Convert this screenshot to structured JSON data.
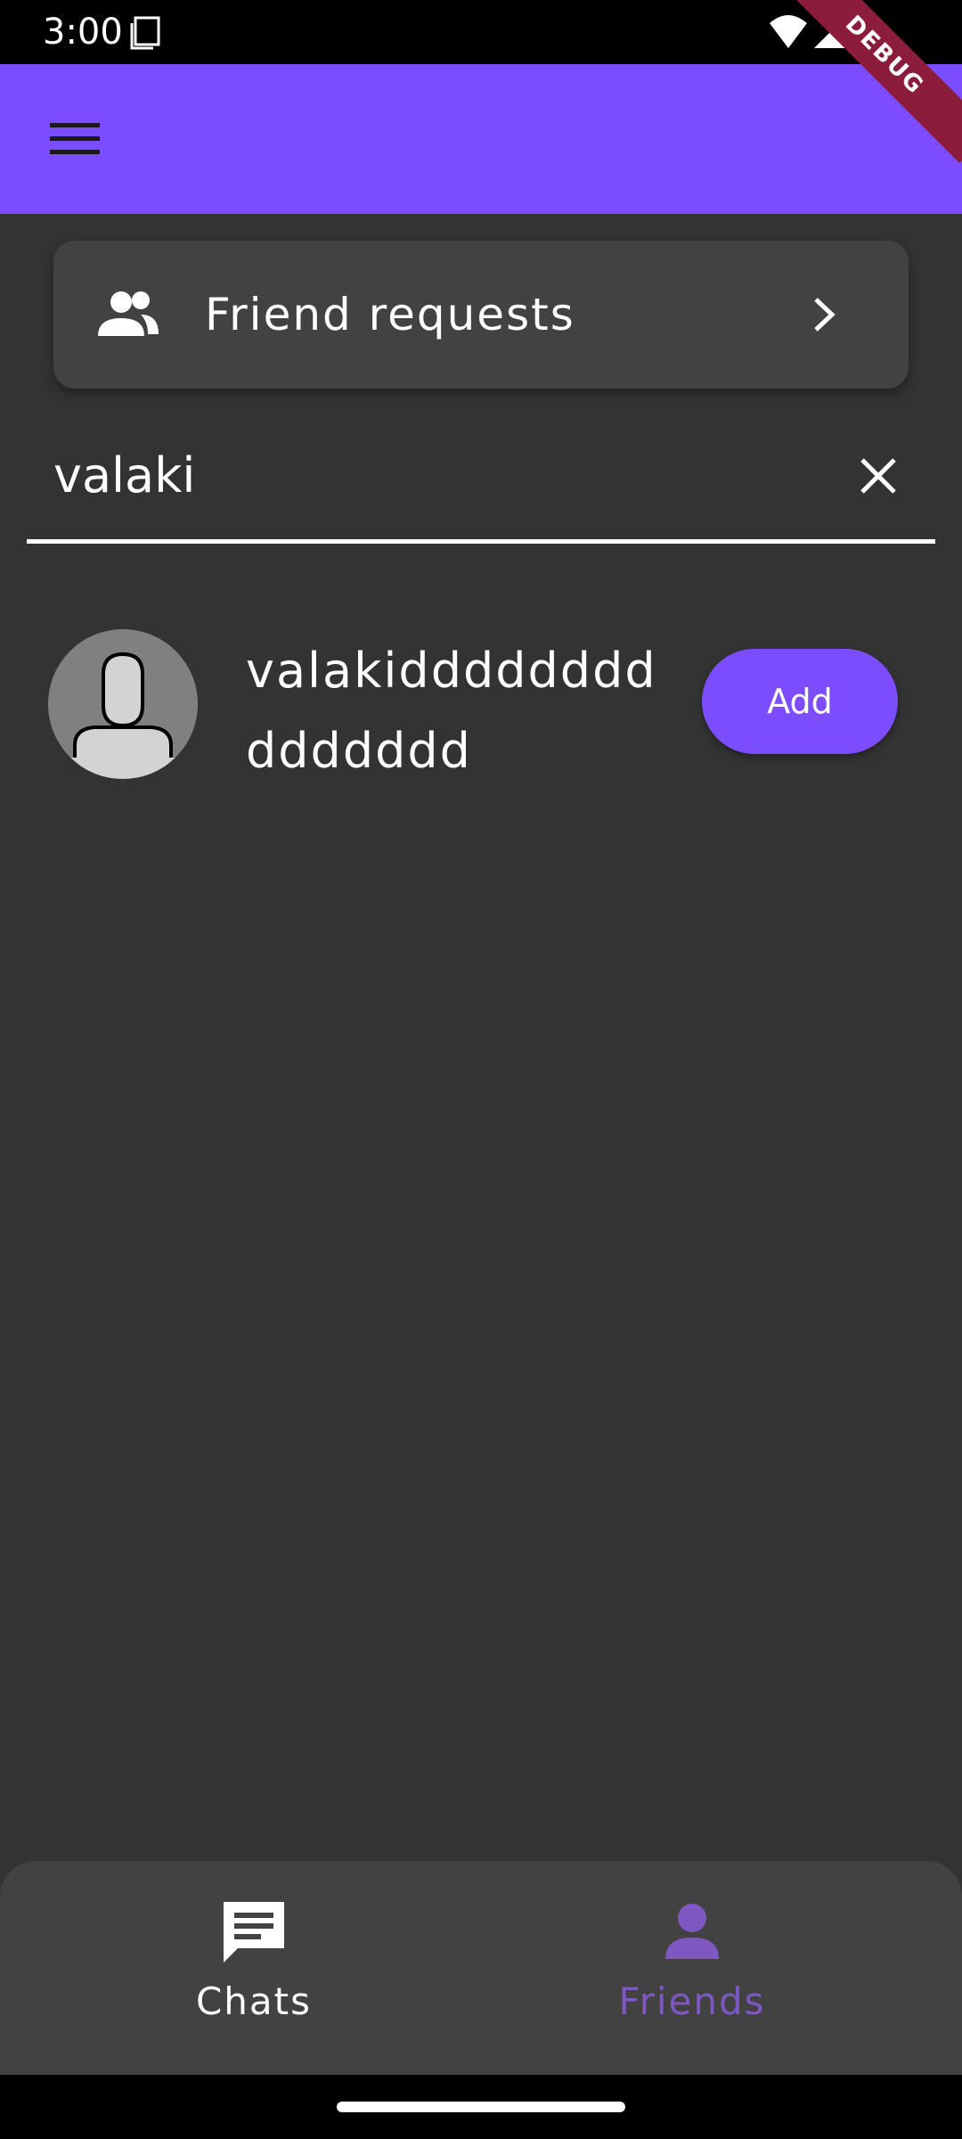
{
  "status_bar": {
    "time": "3:00",
    "icons": [
      "sim-card-icon",
      "wifi-icon",
      "signal-icon"
    ]
  },
  "debug_banner": "DEBUG",
  "app_bar": {
    "menu_icon": "menu-icon",
    "color": "#7c4dff"
  },
  "friend_requests": {
    "label": "Friend requests",
    "icon": "people-icon",
    "trailing_icon": "chevron-right-icon"
  },
  "search": {
    "value": "valaki",
    "clear_icon": "close-icon"
  },
  "results": [
    {
      "name": "valakiddddddddddddddd",
      "avatar_icon": "person-avatar-icon",
      "action_label": "Add"
    }
  ],
  "bottom_nav": {
    "items": [
      {
        "label": "Chats",
        "icon": "chat-icon",
        "selected": false
      },
      {
        "label": "Friends",
        "icon": "person-icon",
        "selected": true
      }
    ],
    "selected_color": "#7e57c2"
  },
  "colors": {
    "background": "#333333",
    "card": "#424242",
    "accent": "#7c4dff"
  }
}
